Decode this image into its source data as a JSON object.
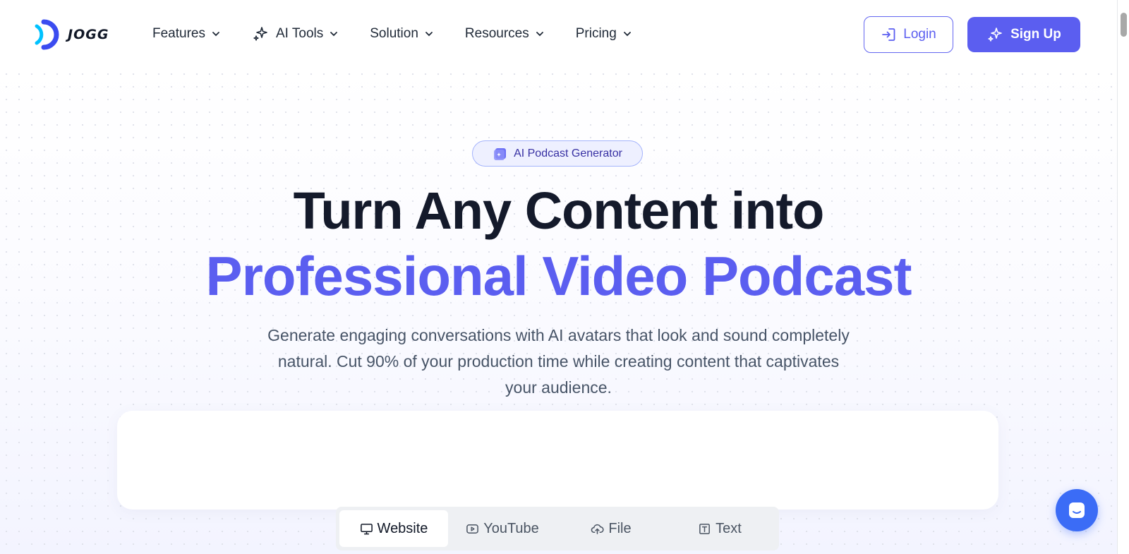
{
  "brand": {
    "name": "JOGG",
    "accent": "#5b5ef0",
    "logo_colors": [
      "#00c2ff",
      "#3b4cf0"
    ]
  },
  "nav": {
    "items": [
      {
        "label": "Features",
        "icon": "chevron-down-icon"
      },
      {
        "label": "AI Tools",
        "icon": "sparkle-icon"
      },
      {
        "label": "Solution",
        "icon": "chevron-down-icon"
      },
      {
        "label": "Resources",
        "icon": "chevron-down-icon"
      },
      {
        "label": "Pricing",
        "icon": "chevron-down-icon"
      }
    ],
    "login_label": "Login",
    "signup_label": "Sign Up"
  },
  "hero": {
    "badge": "AI Podcast Generator",
    "title_line1": "Turn Any Content into",
    "title_line2": "Professional Video Podcast",
    "subtitle_lines": [
      "Generate engaging conversations with AI avatars that look and sound completely",
      "natural. Cut 90% of your production time while creating content that captivates",
      "your audience."
    ]
  },
  "input_tabs": {
    "items": [
      {
        "label": "Website",
        "icon": "monitor-icon",
        "active": true
      },
      {
        "label": "YouTube",
        "icon": "play-icon",
        "active": false
      },
      {
        "label": "File",
        "icon": "cloud-upload-icon",
        "active": false
      },
      {
        "label": "Text",
        "icon": "text-icon",
        "active": false
      }
    ]
  }
}
